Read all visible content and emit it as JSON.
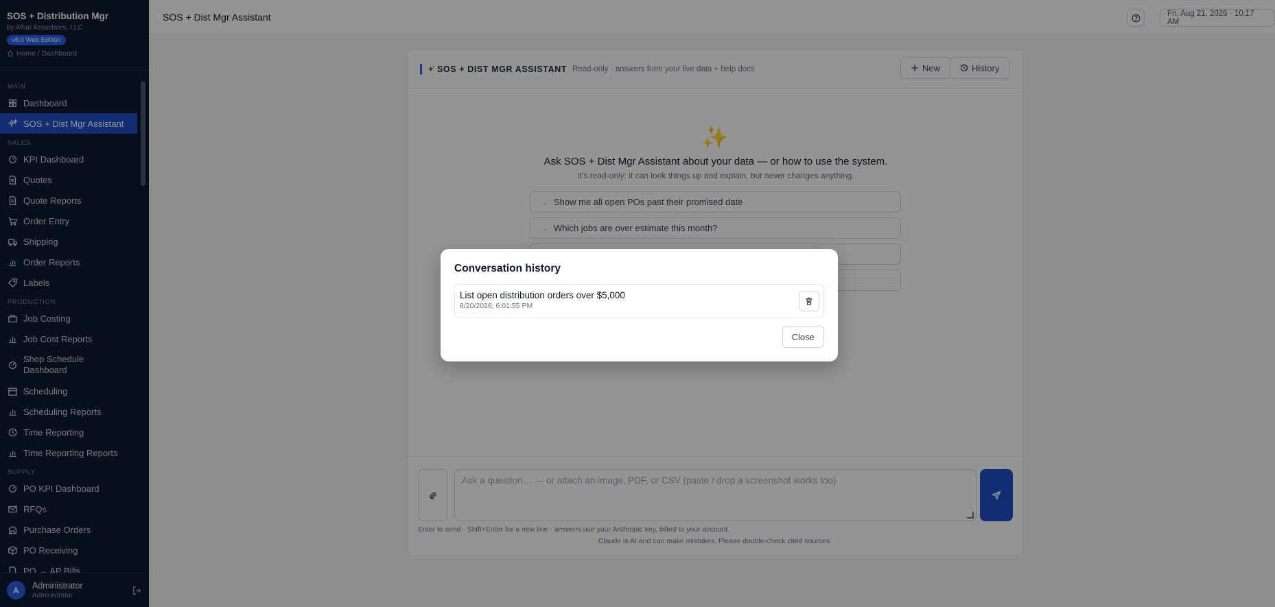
{
  "brand": {
    "title": "SOS + Distribution Mgr",
    "subtitle": "by Affari Associates, LLC",
    "edition": "v8.0 Web Edition",
    "breadcrumb": "Home / Dashboard"
  },
  "sidebar": {
    "main_section": "MAIN",
    "main_items": [
      {
        "label": "Dashboard",
        "icon": "grid-icon"
      },
      {
        "label": "SOS + Dist Mgr Assistant",
        "icon": "sparkle-icon",
        "active": true
      }
    ],
    "sales_section": "SALES",
    "sales_items": [
      {
        "label": "KPI Dashboard",
        "icon": "gauge-icon"
      },
      {
        "label": "Quotes",
        "icon": "document-icon"
      },
      {
        "label": "Quote Reports",
        "icon": "document-icon"
      },
      {
        "label": "Order Entry",
        "icon": "cart-icon"
      },
      {
        "label": "Shipping",
        "icon": "truck-icon"
      },
      {
        "label": "Order Reports",
        "icon": "bar-chart-icon"
      },
      {
        "label": "Labels",
        "icon": "tag-icon"
      }
    ],
    "production_section": "PRODUCTION",
    "production_items": [
      {
        "label": "Job Costing",
        "icon": "briefcase-icon"
      },
      {
        "label": "Job Cost Reports",
        "icon": "bar-chart-icon"
      },
      {
        "label": "Shop Schedule Dashboard",
        "icon": "gauge-icon"
      },
      {
        "label": "Scheduling",
        "icon": "calendar-icon"
      },
      {
        "label": "Scheduling Reports",
        "icon": "bar-chart-icon"
      },
      {
        "label": "Time Reporting",
        "icon": "clock-icon"
      },
      {
        "label": "Time Reporting Reports",
        "icon": "bar-chart-icon"
      }
    ],
    "supply_section": "SUPPLY",
    "supply_items": [
      {
        "label": "PO KPI Dashboard",
        "icon": "gauge-icon"
      },
      {
        "label": "RFQs",
        "icon": "mail-icon"
      },
      {
        "label": "Purchase Orders",
        "icon": "building-icon"
      },
      {
        "label": "PO Receiving",
        "icon": "box-icon"
      },
      {
        "label": "PO → AP Bills",
        "icon": "document-icon"
      }
    ]
  },
  "user": {
    "initial": "A",
    "name": "Administrator",
    "role": "Administrator"
  },
  "topbar": {
    "title": "SOS + Dist Mgr Assistant",
    "datetime": "Fri, Aug 21, 2026 · 10:17 AM"
  },
  "panel": {
    "title": "SOS + DIST MGR ASSISTANT",
    "subtitle": "Read-only · answers from your live data + help docs",
    "new_label": "New",
    "history_label": "History",
    "headline": "Ask SOS + Dist Mgr Assistant about your data — or how to use the system.",
    "subline": "It's read-only: it can look things up and explain, but never changes anything.",
    "suggestions": [
      "Show me all open POs past their promised date",
      "Which jobs are over estimate this month?",
      "",
      ""
    ],
    "input_placeholder": "Ask a question… — or attach an image, PDF, or CSV (paste / drop a screenshot works too)",
    "hint": "Enter to send · Shift+Enter for a new line · answers use your Anthropic key, billed to your account.",
    "disclaimer": "Claude is AI and can make mistakes. Please double-check cited sources."
  },
  "modal": {
    "title": "Conversation history",
    "conversations": [
      {
        "title": "List open distribution orders over $5,000",
        "date": "8/20/2026, 6:01:55 PM"
      }
    ],
    "close_label": "Close"
  }
}
